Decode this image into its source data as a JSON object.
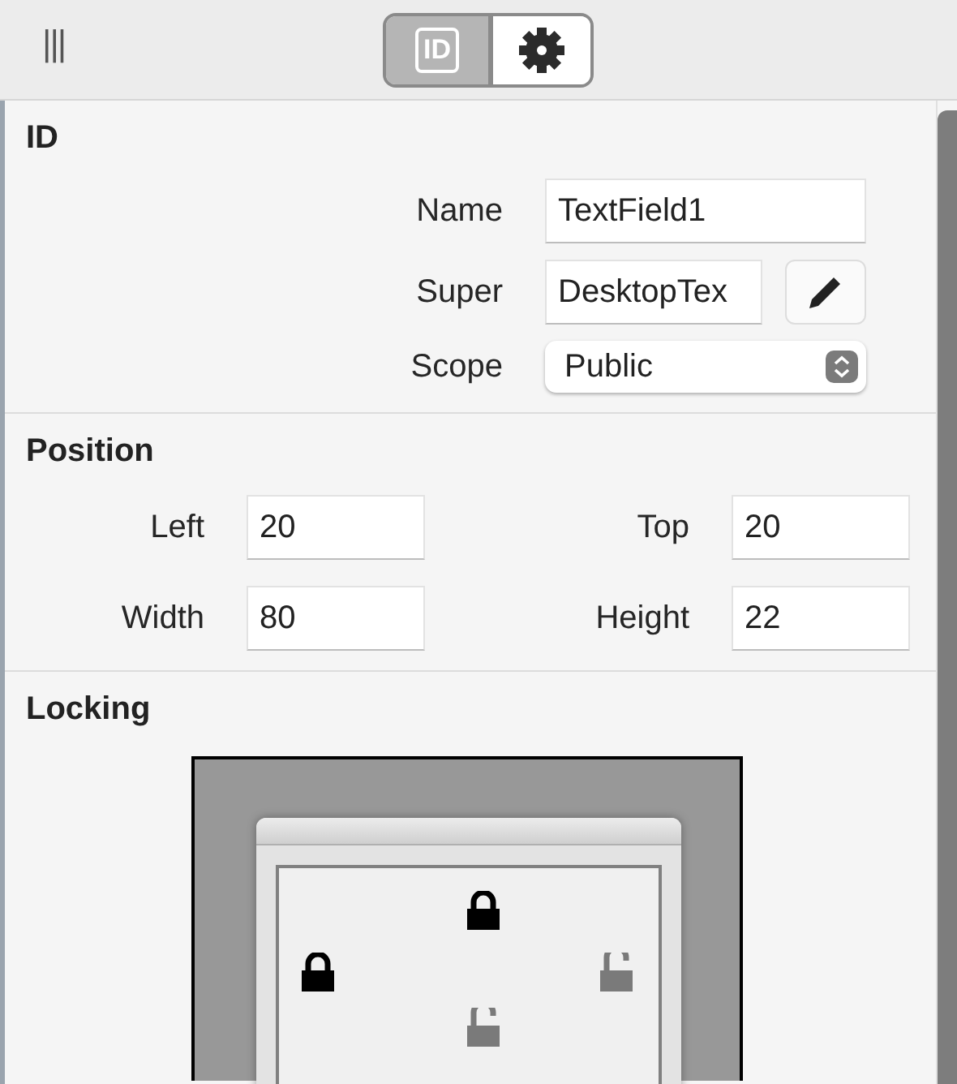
{
  "toolbar": {
    "handle": "|||",
    "tabs": [
      {
        "kind": "id",
        "label": "ID",
        "selected": true
      },
      {
        "kind": "gear",
        "selected": false
      }
    ]
  },
  "id_section": {
    "title": "ID",
    "name": {
      "label": "Name",
      "value": "TextField1"
    },
    "super": {
      "label": "Super",
      "value": "DesktopTex"
    },
    "scope": {
      "label": "Scope",
      "value": "Public"
    }
  },
  "position": {
    "title": "Position",
    "fields": [
      {
        "label": "Left",
        "value": "20"
      },
      {
        "label": "Top",
        "value": "20"
      },
      {
        "label": "Width",
        "value": "80"
      },
      {
        "label": "Height",
        "value": "22"
      }
    ]
  },
  "locking": {
    "title": "Locking",
    "locks": [
      {
        "kind": "top",
        "locked": true
      },
      {
        "kind": "left",
        "locked": true
      },
      {
        "kind": "right",
        "locked": false
      },
      {
        "kind": "bottom",
        "locked": false
      }
    ]
  }
}
